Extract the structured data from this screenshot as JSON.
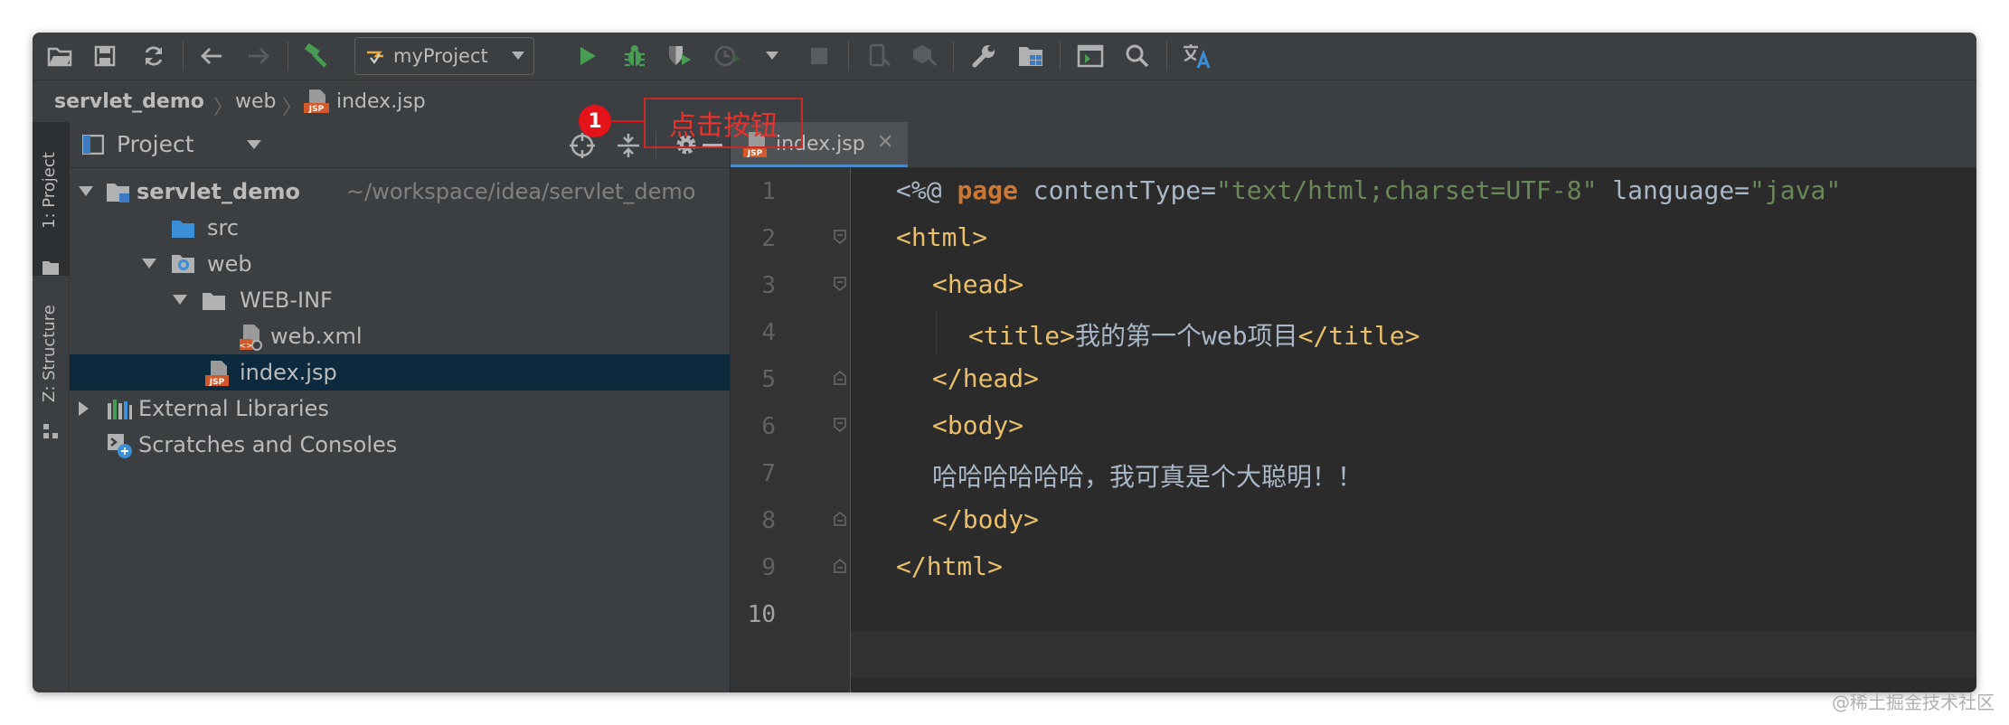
{
  "toolbar": {
    "run_config_label": "myProject"
  },
  "breadcrumb": [
    "servlet_demo",
    "web",
    "index.jsp"
  ],
  "side_tabs": {
    "project": "1: Project",
    "structure": "Z: Structure"
  },
  "project_panel": {
    "title": "Project",
    "tree": [
      {
        "label": "servlet_demo",
        "sub": "~/workspace/idea/servlet_demo"
      },
      {
        "label": "src"
      },
      {
        "label": "web"
      },
      {
        "label": "WEB-INF"
      },
      {
        "label": "web.xml"
      },
      {
        "label": "index.jsp"
      },
      {
        "label": "External Libraries"
      },
      {
        "label": "Scratches and Consoles"
      }
    ]
  },
  "editor": {
    "tab_label": "index.jsp",
    "line_numbers": [
      "1",
      "2",
      "3",
      "4",
      "5",
      "6",
      "7",
      "8",
      "9",
      "10"
    ],
    "code": {
      "l1_a": "<%@ ",
      "l1_kw": "page",
      "l1_attr1": " contentType=",
      "l1_val1": "\"text/html;charset=UTF-8\"",
      "l1_attr2": " language=",
      "l1_val2": "\"java\"",
      "l2": "<html>",
      "l3": "<head>",
      "l4_open": "<title>",
      "l4_text": "我的第一个web项目",
      "l4_close": "</title>",
      "l5": "</head>",
      "l6": "<body>",
      "l7": "哈哈哈哈哈哈，我可真是个大聪明！！",
      "l8": "</body>",
      "l9": "</html>"
    }
  },
  "annotation": {
    "number": "1",
    "text": "点击按钮"
  },
  "watermark": "@稀土掘金技术社区",
  "colors": {
    "accent": "#4a88c7",
    "run": "#499c54",
    "annotation": "#e5131a",
    "tag": "#e8bf6a",
    "keyword": "#cc7832",
    "string": "#6a8759"
  },
  "icons": [
    "open-folder-icon",
    "save-icon",
    "sync-icon",
    "back-icon",
    "forward-icon",
    "build-hammer-icon",
    "run-config-icon",
    "run-icon",
    "debug-icon",
    "coverage-icon",
    "profile-icon",
    "stop-icon",
    "device-icon",
    "sdk-icon",
    "wrench-icon",
    "project-structure-icon",
    "terminal-icon",
    "search-icon",
    "translate-icon"
  ]
}
